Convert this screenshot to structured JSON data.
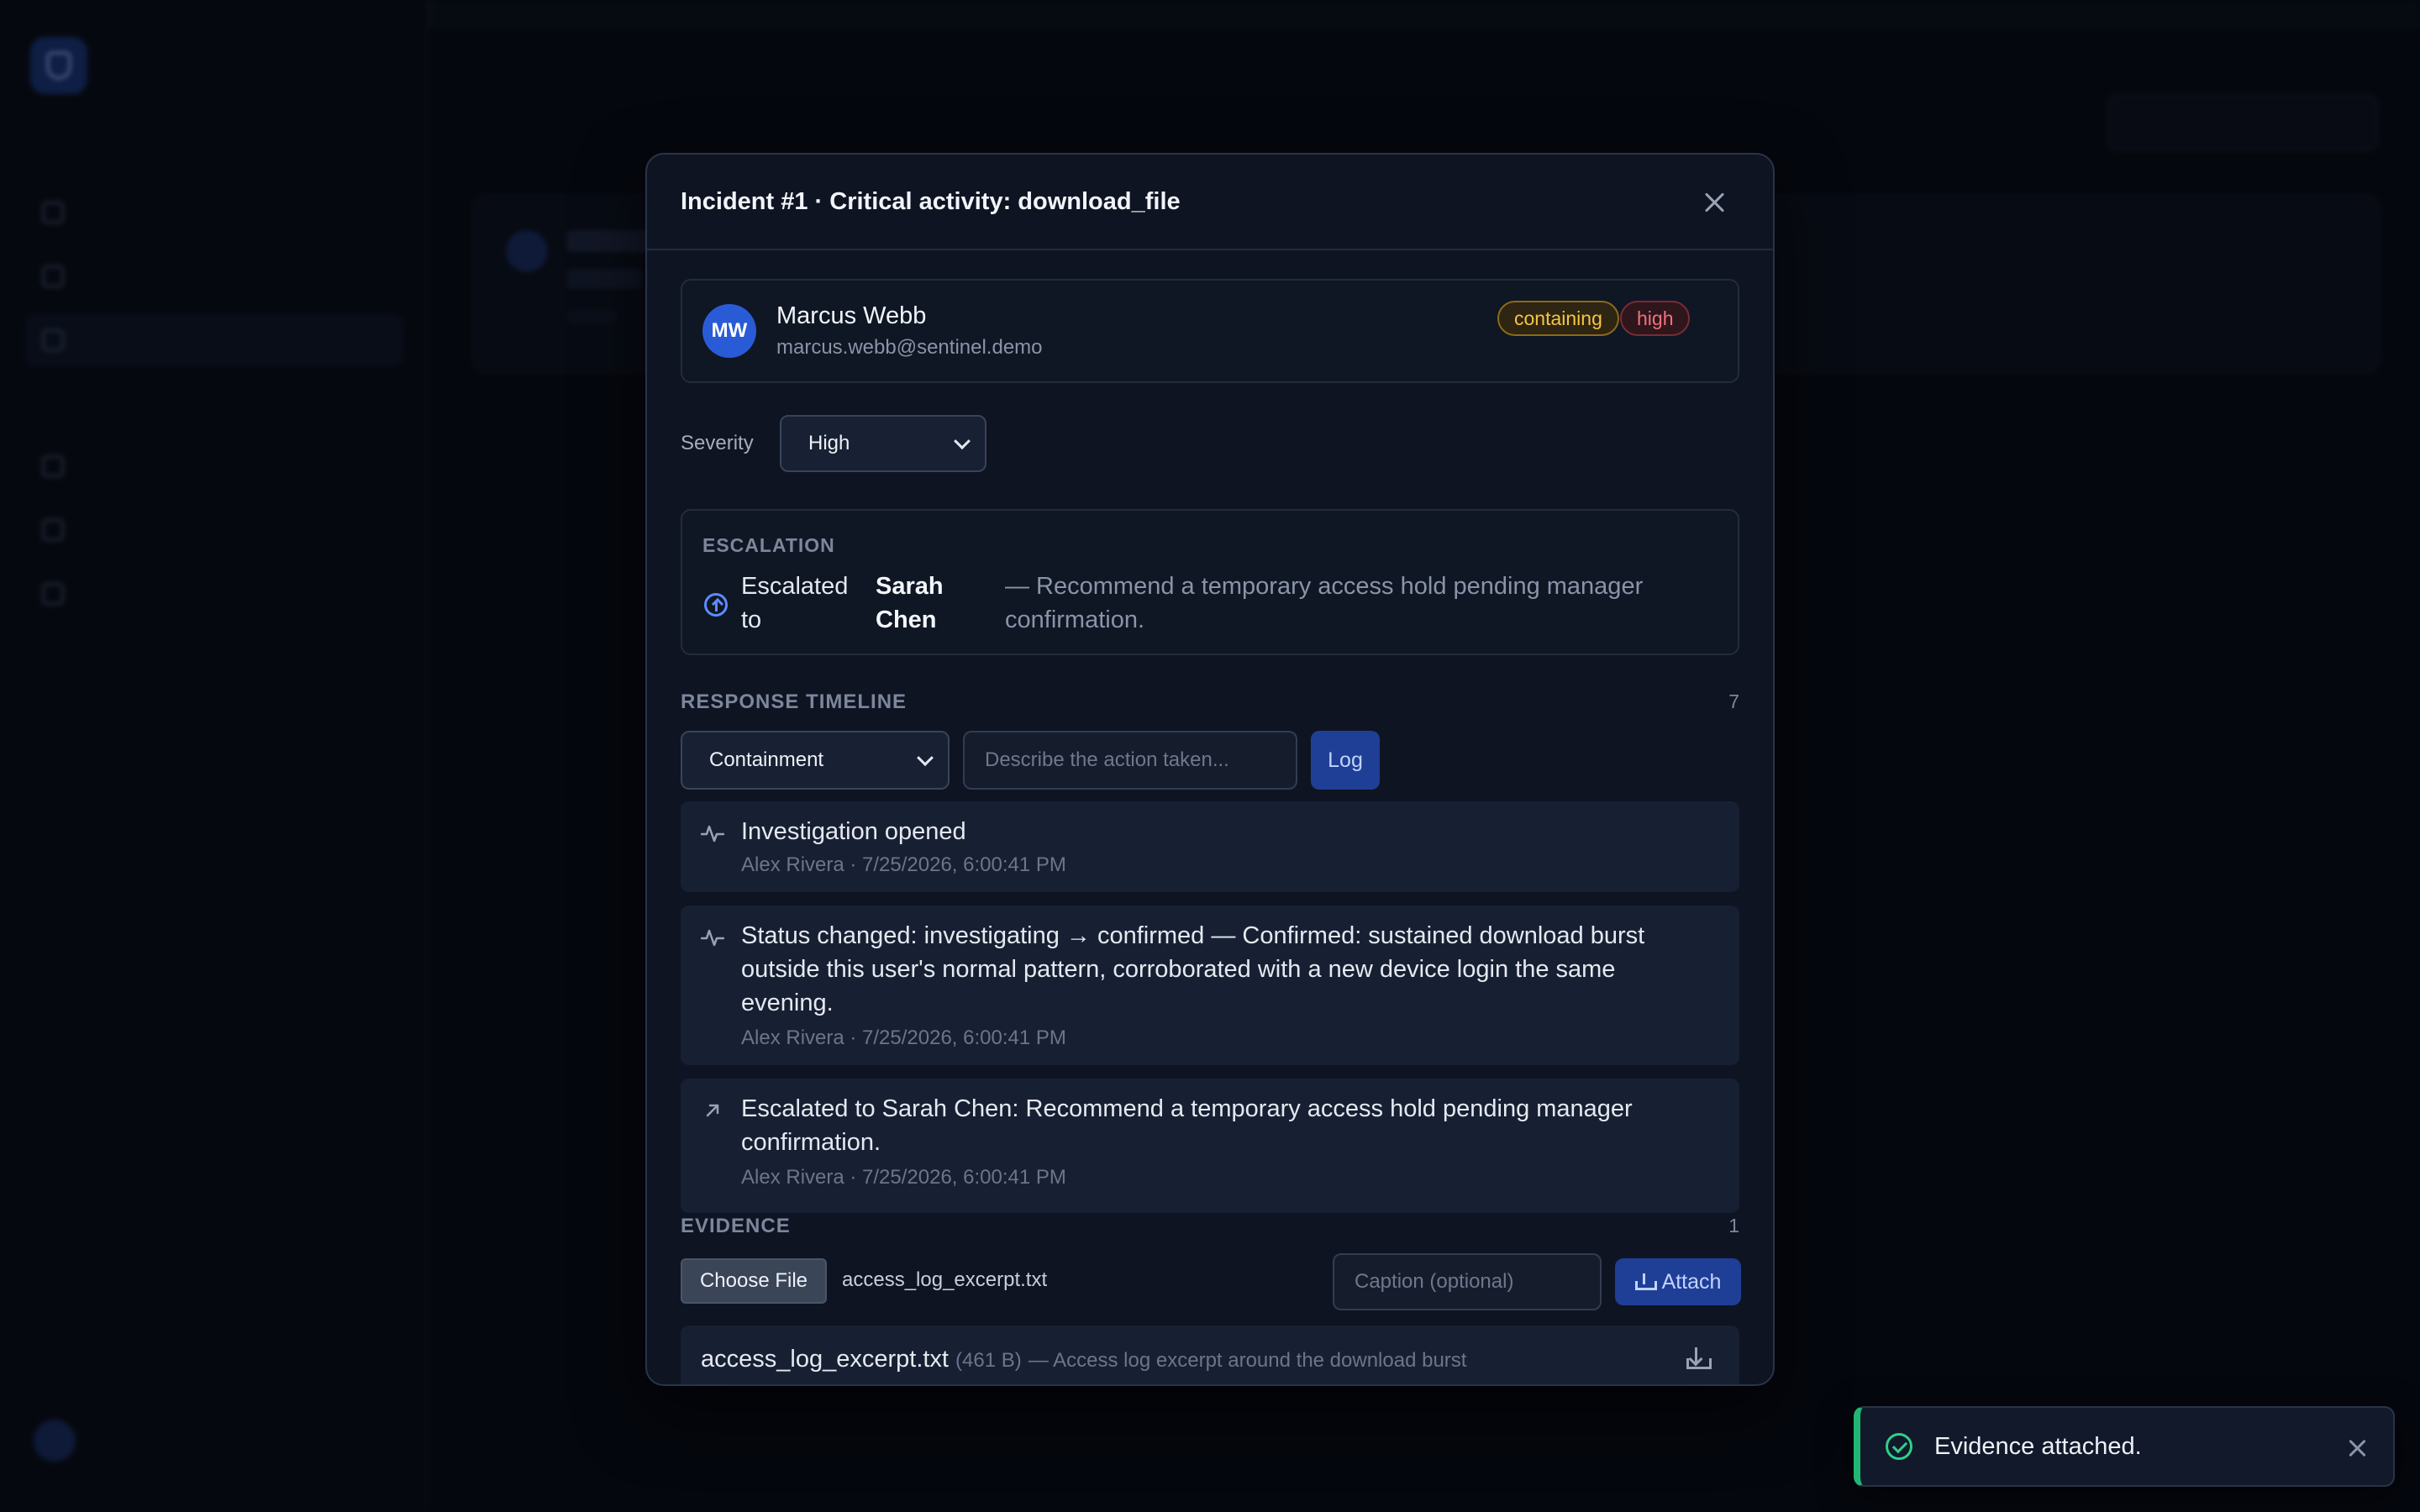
{
  "modal": {
    "title": "Incident #1 · Critical activity: download_file",
    "user": {
      "initials": "MW",
      "name": "Marcus Webb",
      "email": "marcus.webb@sentinel.demo",
      "status_badge": "containing",
      "severity_badge": "high"
    },
    "severity": {
      "label": "Severity",
      "value": "High"
    },
    "escalation": {
      "label": "ESCALATION",
      "prefix": "Escalated to",
      "target": "Sarah Chen",
      "note": "— Recommend a temporary access hold pending manager confirmation."
    },
    "timeline": {
      "label": "RESPONSE TIMELINE",
      "count": "7",
      "type_value": "Containment",
      "input_placeholder": "Describe the action taken...",
      "log_label": "Log",
      "items": [
        {
          "icon": "pulse-icon",
          "text": "Investigation opened",
          "meta": "Alex Rivera · 7/25/2026, 6:00:41 PM"
        },
        {
          "icon": "pulse-icon",
          "text": "Status changed: investigating → confirmed — Confirmed: sustained download burst outside this user's normal pattern, corroborated with a new device login the same evening.",
          "meta": "Alex Rivera · 7/25/2026, 6:00:41 PM"
        },
        {
          "icon": "arrow-up-right-icon",
          "text": "Escalated to Sarah Chen: Recommend a temporary access hold pending manager confirmation.",
          "meta": "Alex Rivera · 7/25/2026, 6:00:41 PM"
        }
      ]
    },
    "evidence": {
      "label": "EVIDENCE",
      "count": "1",
      "choose_label": "Choose File",
      "chosen_file": "access_log_excerpt.txt",
      "caption_placeholder": "Caption (optional)",
      "attach_label": "Attach",
      "items": [
        {
          "name": "access_log_excerpt.txt",
          "size": "(461 B)",
          "desc": "— Access log excerpt around the download burst"
        }
      ]
    }
  },
  "toast": {
    "message": "Evidence attached."
  },
  "colors": {
    "accent": "#2a5bd7",
    "warning": "#f5c542",
    "danger": "#f0727d",
    "success": "#22b573"
  }
}
